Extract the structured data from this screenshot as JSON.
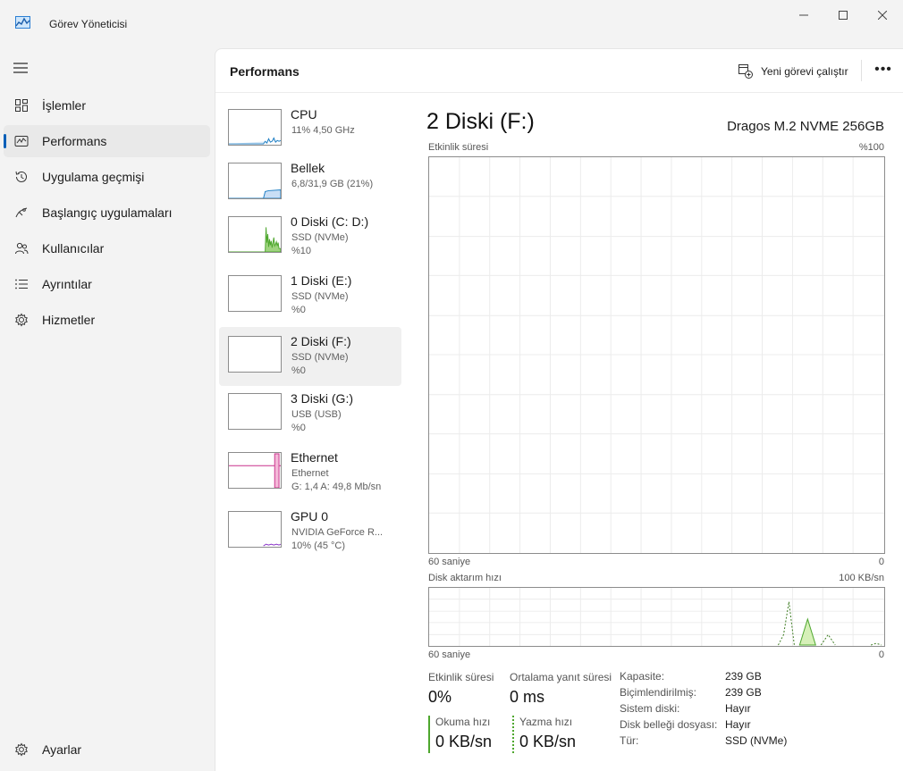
{
  "window": {
    "title": "Görev Yöneticisi",
    "min": "—",
    "max": "☐",
    "close": "✕"
  },
  "nav": {
    "items": [
      {
        "label": "İşlemler",
        "icon": "processes-icon"
      },
      {
        "label": "Performans",
        "icon": "performance-icon",
        "active": true
      },
      {
        "label": "Uygulama geçmişi",
        "icon": "history-icon"
      },
      {
        "label": "Başlangıç uygulamaları",
        "icon": "startup-icon"
      },
      {
        "label": "Kullanıcılar",
        "icon": "users-icon"
      },
      {
        "label": "Ayrıntılar",
        "icon": "details-icon"
      },
      {
        "label": "Hizmetler",
        "icon": "services-icon"
      }
    ],
    "settings": "Ayarlar"
  },
  "header": {
    "title": "Performans",
    "run_task": "Yeni görevi çalıştır",
    "more": "•••"
  },
  "devices": [
    {
      "name": "CPU",
      "line1": "11%  4,50 GHz",
      "line2": ""
    },
    {
      "name": "Bellek",
      "line1": "6,8/31,9 GB (21%)",
      "line2": ""
    },
    {
      "name": "0 Diski (C: D:)",
      "line1": "SSD (NVMe)",
      "line2": "%10"
    },
    {
      "name": "1 Diski (E:)",
      "line1": "SSD (NVMe)",
      "line2": "%0"
    },
    {
      "name": "2 Diski (F:)",
      "line1": "SSD (NVMe)",
      "line2": "%0",
      "active": true
    },
    {
      "name": "3 Diski (G:)",
      "line1": "USB (USB)",
      "line2": "%0"
    },
    {
      "name": "Ethernet",
      "line1": "Ethernet",
      "line2": "G: 1,4  A: 49,8 Mb/sn"
    },
    {
      "name": "GPU 0",
      "line1": "NVIDIA GeForce R...",
      "line2": "10%  (45 °C)"
    }
  ],
  "detail": {
    "title": "2 Diski (F:)",
    "model": "Dragos M.2 NVME 256GB",
    "graph1": {
      "top_left": "Etkinlik süresi",
      "top_right": "%100",
      "bottom_left": "60 saniye",
      "bottom_right": "0"
    },
    "graph2": {
      "top_left": "Disk aktarım hızı",
      "top_right": "100 KB/sn",
      "bottom_left": "60 saniye",
      "bottom_right": "0"
    },
    "stats": {
      "active_time_label": "Etkinlik süresi",
      "active_time_value": "0%",
      "avg_resp_label": "Ortalama yanıt süresi",
      "avg_resp_value": "0 ms",
      "read_label": "Okuma hızı",
      "read_value": "0 KB/sn",
      "write_label": "Yazma hızı",
      "write_value": "0 KB/sn"
    },
    "props": [
      {
        "k": "Kapasite:",
        "v": "239 GB"
      },
      {
        "k": "Biçimlendirilmiş:",
        "v": "239 GB"
      },
      {
        "k": "Sistem diski:",
        "v": "Hayır"
      },
      {
        "k": "Disk belleği dosyası:",
        "v": "Hayır"
      },
      {
        "k": "Tür:",
        "v": "SSD (NVMe)"
      }
    ]
  },
  "colors": {
    "accent": "#005fb8",
    "disk_green": "#4ea72e",
    "disk_fill": "#d6f0b8",
    "cpu_blue": "#1f7fc4",
    "ethernet_pink": "#c9318b",
    "gpu_purple": "#8a35c8"
  }
}
